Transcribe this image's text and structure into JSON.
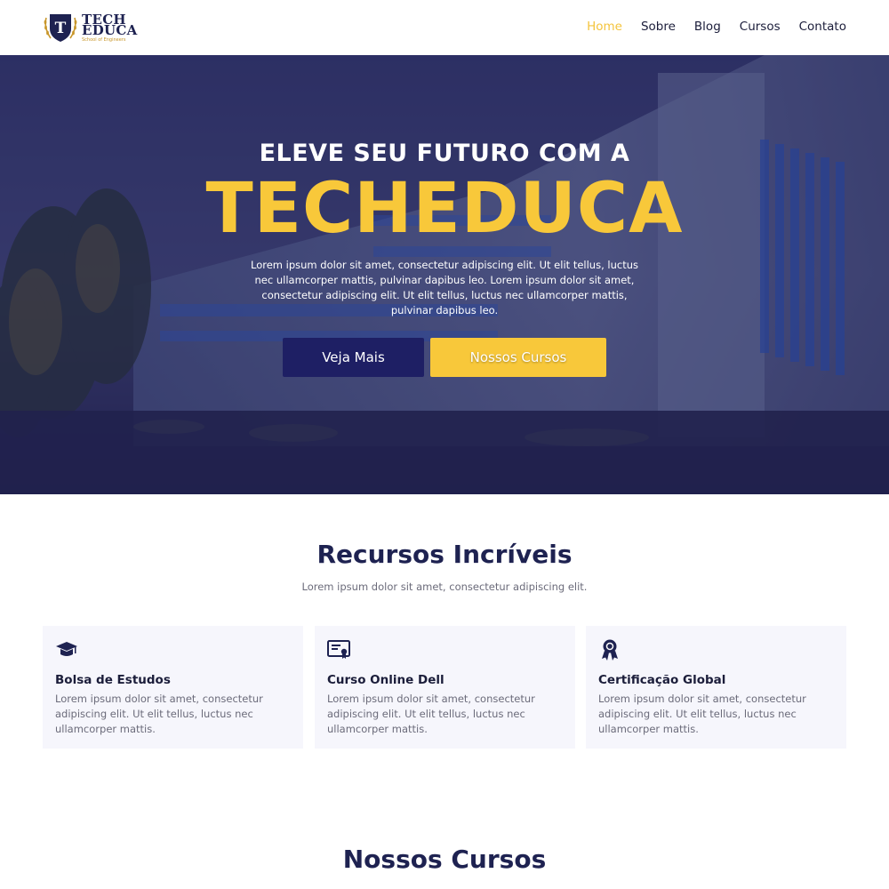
{
  "header": {
    "logo_line1": "TECH",
    "logo_line2": "EDUCA",
    "logo_tagline": "School of Engineers",
    "nav": [
      {
        "label": "Home",
        "active": true
      },
      {
        "label": "Sobre"
      },
      {
        "label": "Blog"
      },
      {
        "label": "Cursos"
      },
      {
        "label": "Contato"
      }
    ]
  },
  "hero": {
    "subtitle": "ELEVE SEU FUTURO COM A",
    "title": "TECHEDUCA",
    "description": "Lorem ipsum dolor sit amet, consectetur adipiscing elit. Ut elit tellus, luctus nec ullamcorper mattis, pulvinar dapibus leo. Lorem ipsum dolor sit amet, consectetur adipiscing elit. Ut elit tellus, luctus nec ullamcorper mattis, pulvinar dapibus leo.",
    "btn_primary": "Veja Mais",
    "btn_secondary": "Nossos Cursos"
  },
  "features": {
    "title": "Recursos Incríveis",
    "subtitle": "Lorem ipsum dolor sit amet, consectetur adipiscing elit.",
    "cards": [
      {
        "icon": "graduation-cap-icon",
        "title": "Bolsa de Estudos",
        "text": "Lorem ipsum dolor sit amet, consectetur adipiscing elit. Ut elit tellus, luctus nec ullamcorper mattis."
      },
      {
        "icon": "certificate-icon",
        "title": "Curso Online Dell",
        "text": "Lorem ipsum dolor sit amet, consectetur adipiscing elit. Ut elit tellus, luctus nec ullamcorper mattis."
      },
      {
        "icon": "award-ribbon-icon",
        "title": "Certificação Global",
        "text": "Lorem ipsum dolor sit amet, consectetur adipiscing elit. Ut elit tellus, luctus nec ullamcorper mattis."
      }
    ]
  },
  "courses": {
    "title": "Nossos Cursos"
  },
  "colors": {
    "brand_navy": "#1e2251",
    "accent_yellow": "#f8c83a",
    "button_navy": "#1e1f64",
    "card_bg": "#f6f6fc"
  }
}
